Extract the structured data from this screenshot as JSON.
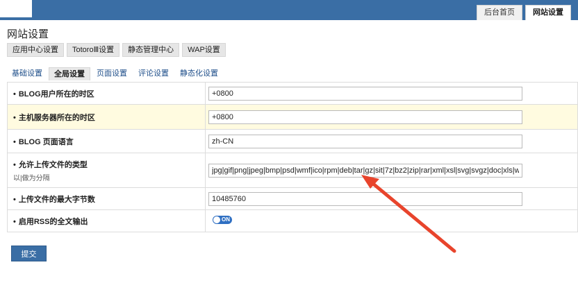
{
  "header": {
    "tabs": [
      {
        "label": "后台首页",
        "active": false
      },
      {
        "label": "网站设置",
        "active": true
      }
    ]
  },
  "page": {
    "title": "网站设置"
  },
  "subnav": [
    "应用中心设置",
    "TotoroⅢ设置",
    "静态管理中心",
    "WAP设置"
  ],
  "tabs": [
    {
      "label": "基础设置",
      "active": false
    },
    {
      "label": "全局设置",
      "active": true
    },
    {
      "label": "页面设置",
      "active": false
    },
    {
      "label": "评论设置",
      "active": false
    },
    {
      "label": "静态化设置",
      "active": false
    }
  ],
  "form": {
    "rows": [
      {
        "label": "BLOG用户所在的时区",
        "value": "+0800"
      },
      {
        "label": "主机服务器所在的时区",
        "value": "+0800"
      },
      {
        "label": "BLOG 页面语言",
        "value": "zh-CN"
      },
      {
        "label": "允许上传文件的类型",
        "hint": "以|做为分隔",
        "value": "jpg|gif|png|jpeg|bmp|psd|wmf|ico|rpm|deb|tar|gz|sit|7z|bz2|zip|rar|xml|xsl|svg|svgz|doc|xls|wp"
      },
      {
        "label": "上传文件的最大字节数",
        "value": "10485760"
      },
      {
        "label": "启用RSS的全文输出",
        "toggle": "ON"
      }
    ],
    "bullet": "•",
    "submit_label": "提交"
  },
  "colors": {
    "header": "#3a6ea5",
    "highlight_row": "#fffbe0",
    "annotation_arrow": "#e8442c"
  }
}
